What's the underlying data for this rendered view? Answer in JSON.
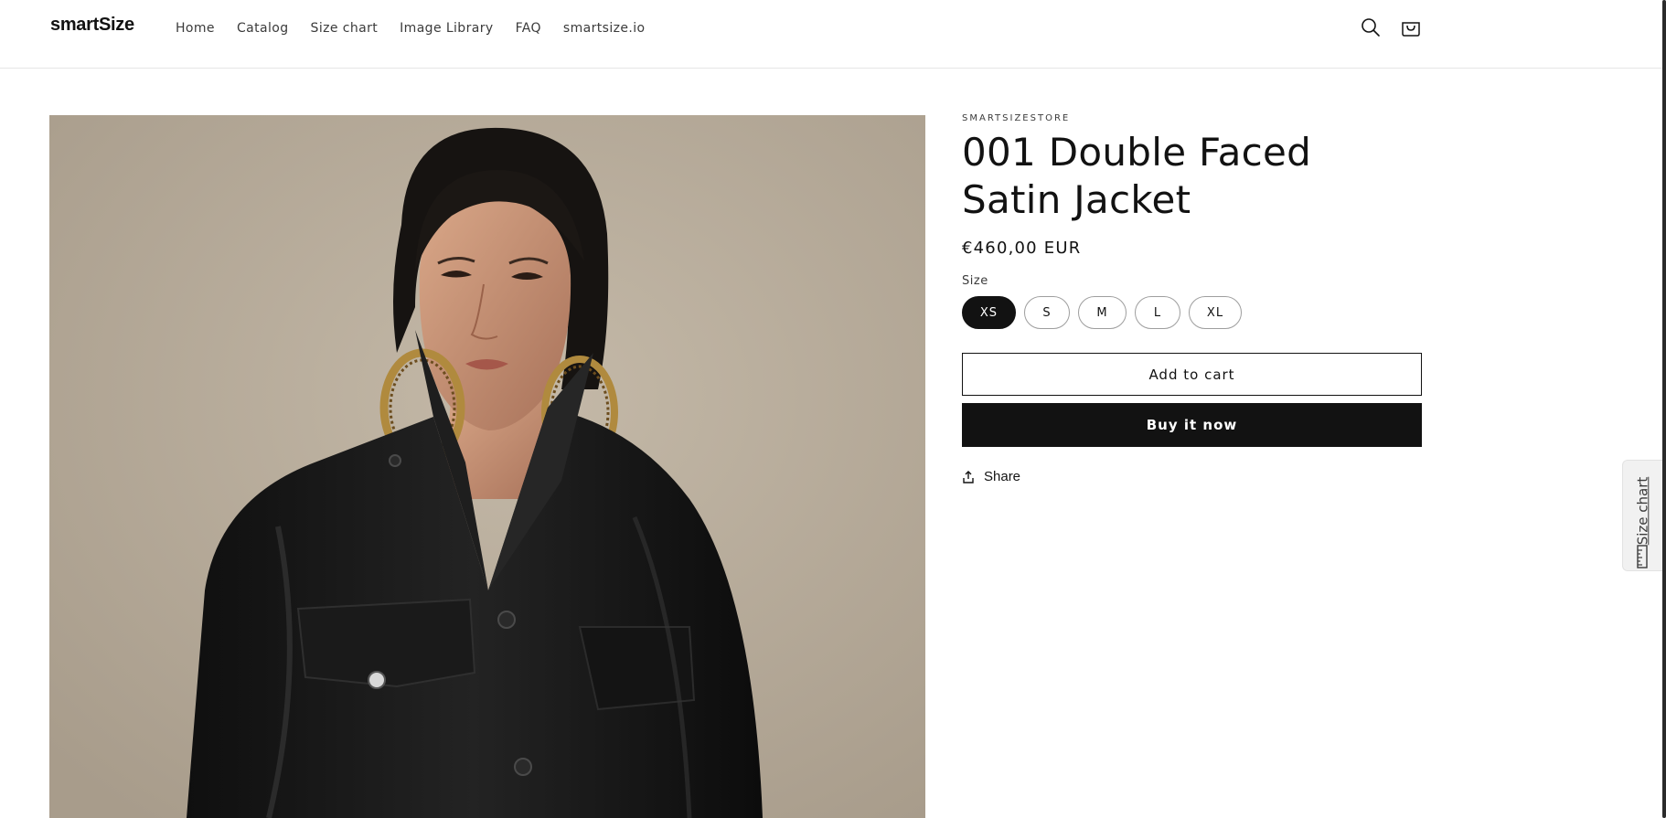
{
  "header": {
    "logo_text": "smartSize",
    "nav": [
      {
        "label": "Home"
      },
      {
        "label": "Catalog"
      },
      {
        "label": "Size chart"
      },
      {
        "label": "Image Library"
      },
      {
        "label": "FAQ"
      },
      {
        "label": "smartsize.io"
      }
    ],
    "icons": [
      "search-icon",
      "cart-icon"
    ]
  },
  "product": {
    "vendor": "SMARTSIZESTORE",
    "title": "001 Double Faced Satin Jacket",
    "price": "€460,00 EUR",
    "size_label": "Size",
    "sizes": [
      {
        "label": "XS",
        "selected": true
      },
      {
        "label": "S",
        "selected": false
      },
      {
        "label": "M",
        "selected": false
      },
      {
        "label": "L",
        "selected": false
      },
      {
        "label": "XL",
        "selected": false
      }
    ],
    "add_to_cart_label": "Add to cart",
    "buy_now_label": "Buy it now",
    "share_label": "Share"
  },
  "size_chart_tab": {
    "label": "Size chart",
    "icon": "ruler-icon"
  },
  "colors": {
    "text": "#121212",
    "button_dark": "#121212",
    "photo_background": "#b7ab9a",
    "jacket": "#161616"
  }
}
